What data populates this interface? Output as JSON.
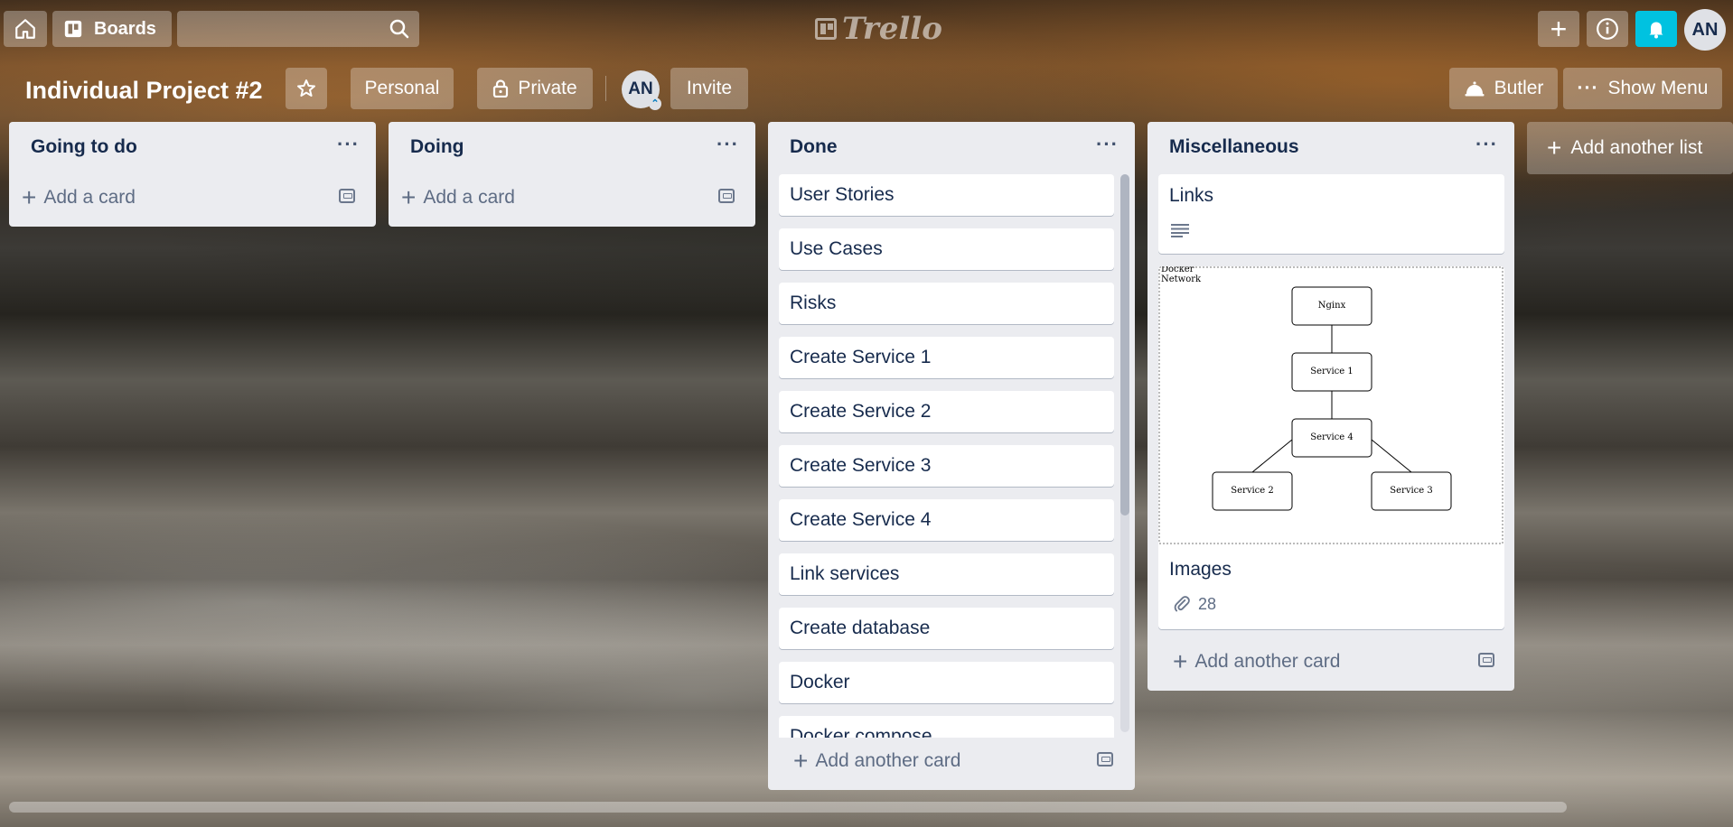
{
  "header": {
    "boards_label": "Boards",
    "search_placeholder": "",
    "logo_text": "Trello",
    "create_label": "+",
    "info_label": "i",
    "user_initials": "AN"
  },
  "board": {
    "title": "Individual Project #2",
    "team_label": "Personal",
    "visibility_label": "Private",
    "member_initials": "AN",
    "invite_label": "Invite",
    "butler_label": "Butler",
    "show_menu_label": "Show Menu"
  },
  "lists": {
    "going": {
      "title": "Going to do",
      "add_label": "Add a card"
    },
    "doing": {
      "title": "Doing",
      "add_label": "Add a card"
    },
    "done": {
      "title": "Done",
      "add_label": "Add another card",
      "cards": [
        "User Stories",
        "Use Cases",
        "Risks",
        "Create Service 1",
        "Create Service 2",
        "Create Service 3",
        "Create Service 4",
        "Link services",
        "Create database",
        "Docker",
        "Docker compose"
      ]
    },
    "misc": {
      "title": "Miscellaneous",
      "add_label": "Add another card",
      "links_card": {
        "title": "Links"
      },
      "images_card": {
        "title": "Images",
        "attachment_count": "28"
      },
      "diagram": {
        "network_label": "Docker Network",
        "nodes": [
          "Nginx",
          "Service 1",
          "Service 4",
          "Service 2",
          "Service 3"
        ]
      }
    }
  },
  "add_list_label": "Add another list",
  "colors": {
    "notification": "#00c2e0",
    "list_bg": "#ebecf0",
    "text": "#172b4d"
  }
}
